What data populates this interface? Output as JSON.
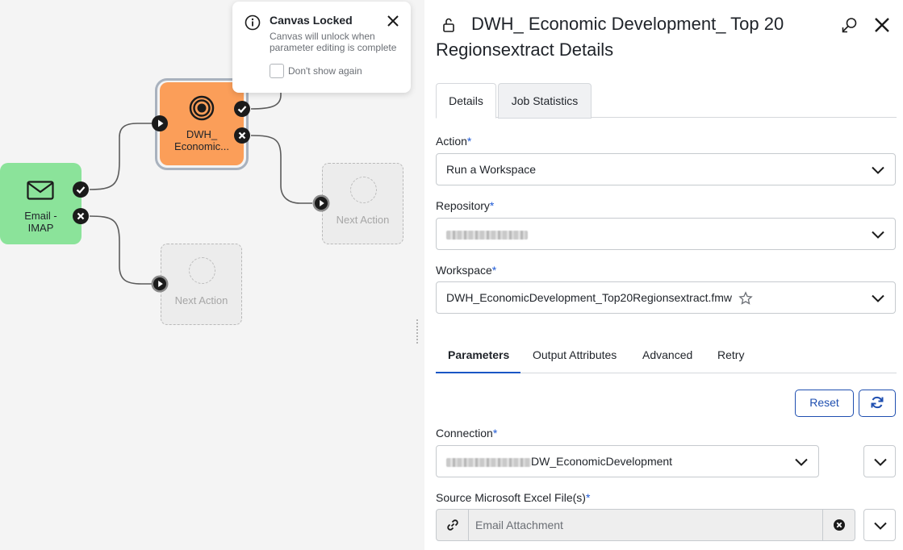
{
  "canvas": {
    "nodes": {
      "email": {
        "label_line1": "Email -",
        "label_line2": "IMAP",
        "color": "#8be39a",
        "icon": "envelope-icon"
      },
      "dwh": {
        "label_line1": "DWH_",
        "label_line2": "Economic...",
        "color": "#fb9e59",
        "icon": "target-icon"
      },
      "next_top": {
        "label": "Next Action"
      },
      "next_bottom": {
        "label": "Next Action"
      }
    },
    "toast": {
      "title": "Canvas Locked",
      "message": "Canvas will unlock when parameter editing is complete",
      "checkbox_label": "Don't show again",
      "checkbox_checked": false
    }
  },
  "panel": {
    "title": "DWH_ Economic Development_ Top 20 Regionsextract Details",
    "tabs": [
      {
        "label": "Details",
        "active": true
      },
      {
        "label": "Job Statistics",
        "active": false
      }
    ],
    "required_marker": "*",
    "action": {
      "label": "Action",
      "value": "Run a Workspace"
    },
    "repository": {
      "label": "Repository",
      "value": ""
    },
    "workspace": {
      "label": "Workspace",
      "value": "DWH_EconomicDevelopment_Top20Regionsextract.fmw"
    },
    "subtabs": [
      {
        "label": "Parameters",
        "active": true
      },
      {
        "label": "Output Attributes",
        "active": false
      },
      {
        "label": "Advanced",
        "active": false
      },
      {
        "label": "Retry",
        "active": false
      }
    ],
    "reset_label": "Reset",
    "connection": {
      "label": "Connection",
      "value_suffix": "DW_EconomicDevelopment"
    },
    "source": {
      "label": "Source Microsoft Excel File(s)",
      "value": "Email Attachment"
    },
    "accent_color": "#1f4fb0"
  }
}
